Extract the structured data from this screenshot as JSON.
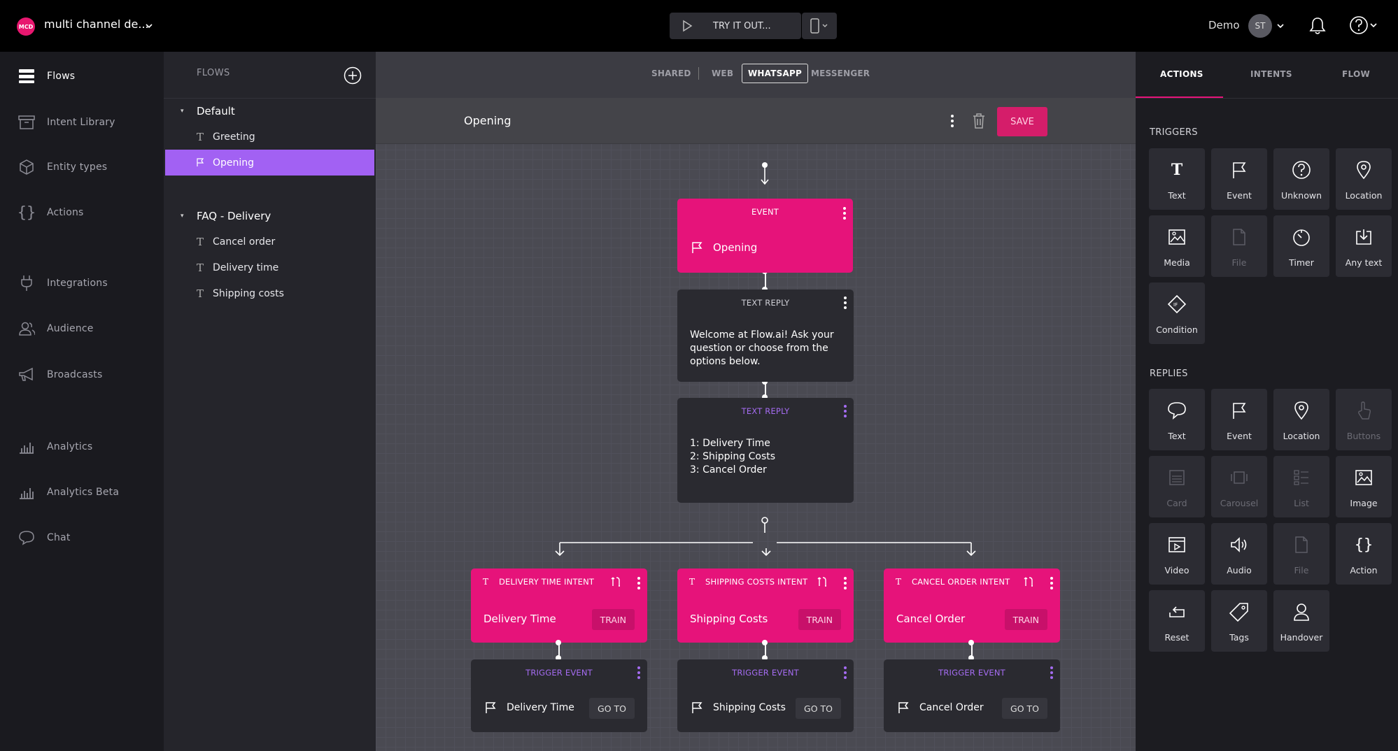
{
  "topbar": {
    "logo_text": "MCD",
    "project_name": "multi channel de...",
    "try_label": "TRY IT OUT...",
    "user_name": "Demo",
    "avatar_initials": "ST"
  },
  "leftnav": {
    "items": [
      {
        "label": "Flows",
        "icon": "flows-icon"
      },
      {
        "label": "Intent Library",
        "icon": "archive-icon"
      },
      {
        "label": "Entity types",
        "icon": "cube-icon"
      },
      {
        "label": "Actions",
        "icon": "braces-icon"
      },
      {
        "label": "Integrations",
        "icon": "plug-icon"
      },
      {
        "label": "Audience",
        "icon": "users-icon"
      },
      {
        "label": "Broadcasts",
        "icon": "megaphone-icon"
      },
      {
        "label": "Analytics",
        "icon": "bar-chart-icon"
      },
      {
        "label": "Analytics Beta",
        "icon": "bar-chart-icon"
      },
      {
        "label": "Chat",
        "icon": "chat-bubble-icon"
      }
    ]
  },
  "flows": {
    "header": "FLOWS",
    "groups": [
      {
        "label": "Default",
        "items": [
          "Greeting",
          "Opening"
        ]
      },
      {
        "label": "FAQ - Delivery",
        "items": [
          "Cancel order",
          "Delivery time",
          "Shipping costs"
        ]
      }
    ]
  },
  "channels": [
    "SHARED",
    "WEB",
    "WHATSAPP",
    "MESSENGER"
  ],
  "active_channel": "WHATSAPP",
  "flow_title": "Opening",
  "save_label": "SAVE",
  "nodes": {
    "event": {
      "header": "EVENT",
      "label": "Opening"
    },
    "reply1": {
      "header": "TEXT REPLY",
      "text": "Welcome at Flow.ai! Ask your question or choose from the options below."
    },
    "reply2": {
      "header": "TEXT REPLY",
      "lines": [
        "1:  Delivery Time",
        "2: Shipping Costs",
        "3: Cancel Order"
      ]
    },
    "intents": [
      {
        "header": "DELIVERY TIME INTENT",
        "label": "Delivery Time",
        "button": "TRAIN"
      },
      {
        "header": "SHIPPING COSTS INTENT",
        "label": "Shipping Costs",
        "button": "TRAIN"
      },
      {
        "header": "CANCEL ORDER INTENT",
        "label": "Cancel Order",
        "button": "TRAIN"
      }
    ],
    "triggers": [
      {
        "header": "TRIGGER EVENT",
        "label": "Delivery Time",
        "button": "GO TO"
      },
      {
        "header": "TRIGGER EVENT",
        "label": "Shipping Costs",
        "button": "GO TO"
      },
      {
        "header": "TRIGGER EVENT",
        "label": "Cancel Order",
        "button": "GO TO"
      }
    ]
  },
  "right": {
    "tabs": [
      "ACTIONS",
      "INTENTS",
      "FLOW"
    ],
    "triggers_title": "TRIGGERS",
    "triggers": [
      {
        "label": "Text",
        "icon": "text-icon"
      },
      {
        "label": "Event",
        "icon": "flag-icon"
      },
      {
        "label": "Unknown",
        "icon": "question-icon"
      },
      {
        "label": "Location",
        "icon": "pin-icon"
      },
      {
        "label": "Media",
        "icon": "image-icon"
      },
      {
        "label": "File",
        "icon": "file-icon",
        "disabled": true
      },
      {
        "label": "Timer",
        "icon": "timer-icon"
      },
      {
        "label": "Any text",
        "icon": "download-icon"
      },
      {
        "label": "Condition",
        "icon": "condition-icon"
      }
    ],
    "replies_title": "REPLIES",
    "replies": [
      {
        "label": "Text",
        "icon": "speech-bubble-icon"
      },
      {
        "label": "Event",
        "icon": "flag-icon"
      },
      {
        "label": "Location",
        "icon": "pin-icon"
      },
      {
        "label": "Buttons",
        "icon": "pointer-icon",
        "disabled": true
      },
      {
        "label": "Card",
        "icon": "card-icon",
        "disabled": true
      },
      {
        "label": "Carousel",
        "icon": "carousel-icon",
        "disabled": true
      },
      {
        "label": "List",
        "icon": "list-icon",
        "disabled": true
      },
      {
        "label": "Image",
        "icon": "image-icon"
      },
      {
        "label": "Video",
        "icon": "video-icon"
      },
      {
        "label": "Audio",
        "icon": "speaker-icon"
      },
      {
        "label": "File",
        "icon": "file-icon",
        "disabled": true
      },
      {
        "label": "Action",
        "icon": "braces-icon"
      },
      {
        "label": "Reset",
        "icon": "reset-icon"
      },
      {
        "label": "Tags",
        "icon": "tag-icon"
      },
      {
        "label": "Handover",
        "icon": "person-icon"
      }
    ]
  },
  "colors": {
    "accent": "#e6137a",
    "purple": "#a56cf2",
    "selected": "#a261f3"
  }
}
